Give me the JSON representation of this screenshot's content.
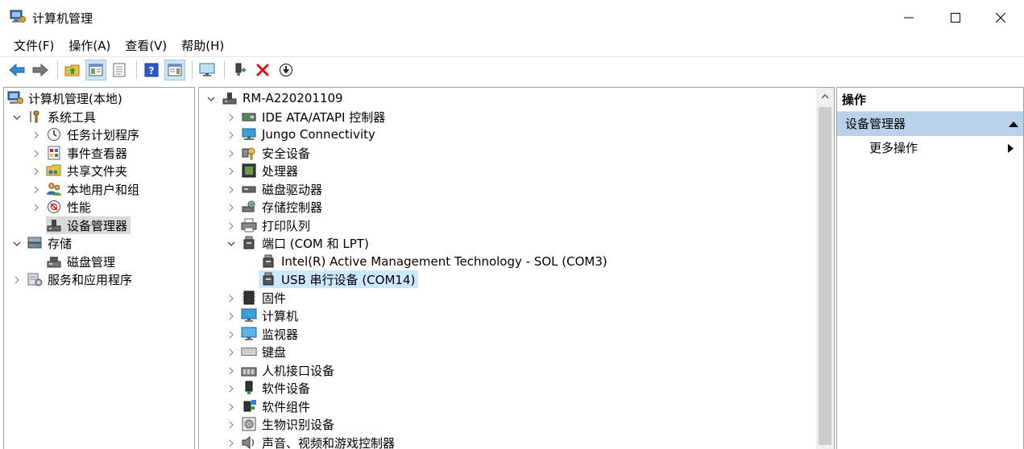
{
  "window": {
    "title": "计算机管理"
  },
  "menu": [
    {
      "label": "文件(F)"
    },
    {
      "label": "操作(A)"
    },
    {
      "label": "查看(V)"
    },
    {
      "label": "帮助(H)"
    }
  ],
  "left_tree": {
    "root": "计算机管理(本地)",
    "system_tools": "系统工具",
    "task_scheduler": "任务计划程序",
    "event_viewer": "事件查看器",
    "shared_folders": "共享文件夹",
    "local_users": "本地用户和组",
    "performance": "性能",
    "device_manager": "设备管理器",
    "storage": "存储",
    "disk_management": "磁盘管理",
    "services_apps": "服务和应用程序"
  },
  "device_tree": {
    "root": "RM-A220201109",
    "ide": "IDE ATA/ATAPI 控制器",
    "jungo": "Jungo Connectivity",
    "security": "安全设备",
    "processor": "处理器",
    "disk_drives": "磁盘驱动器",
    "storage_ctrl": "存储控制器",
    "print_queue": "打印队列",
    "ports": "端口 (COM 和 LPT)",
    "port_intel": "Intel(R) Active Management Technology - SOL (COM3)",
    "port_usb": "USB 串行设备 (COM14)",
    "firmware": "固件",
    "computer": "计算机",
    "monitors": "监视器",
    "keyboards": "键盘",
    "hid": "人机接口设备",
    "software_devices": "软件设备",
    "software_components": "软件组件",
    "biometric": "生物识别设备",
    "sound": "声音、视频和游戏控制器"
  },
  "actions": {
    "header": "操作",
    "section": "设备管理器",
    "more": "更多操作"
  }
}
